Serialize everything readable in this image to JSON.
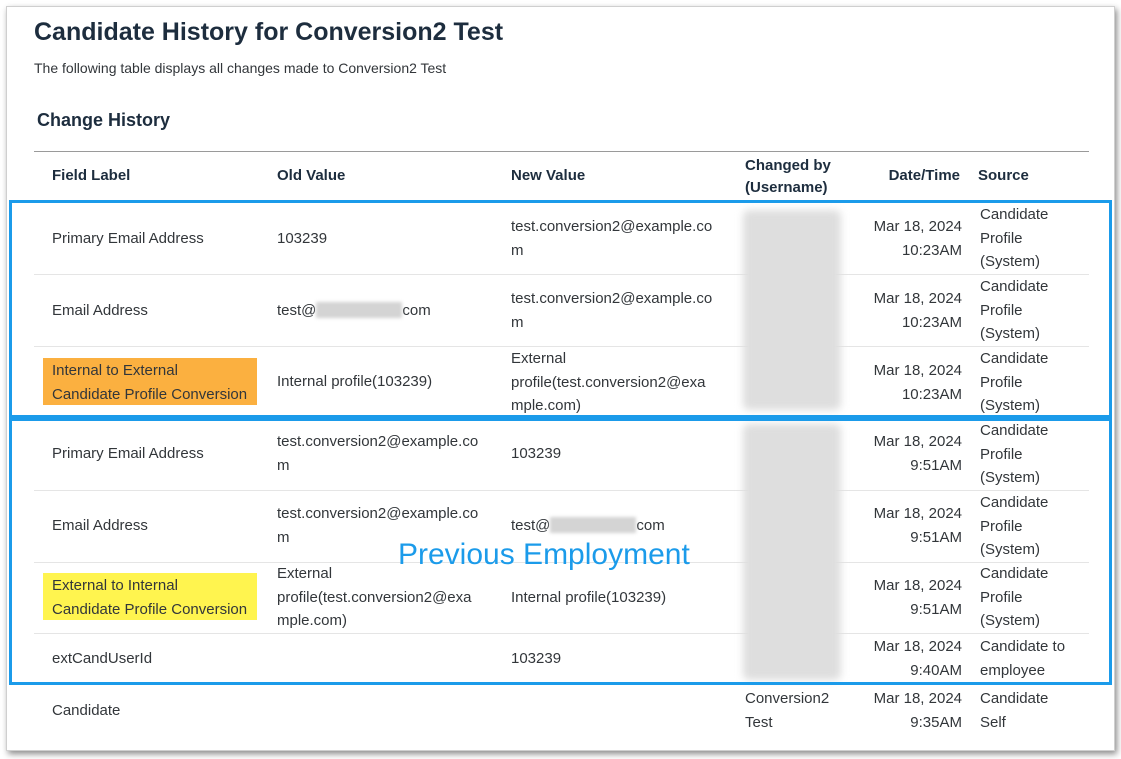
{
  "page": {
    "title": "Candidate History for Conversion2 Test",
    "subtitle": "The following table displays all changes made to Conversion2 Test",
    "section_title": "Change History"
  },
  "table": {
    "columns": {
      "field_label": "Field Label",
      "old_value": "Old Value",
      "new_value": "New Value",
      "changed_by_1": "Changed by",
      "changed_by_2": "(Username)",
      "date_time": "Date/Time",
      "source": "Source"
    },
    "rows": [
      {
        "field": "Primary Email Address",
        "old": "103239",
        "new_1": "test.conversion2@example.co",
        "new_2": "m",
        "date": "Mar 18, 2024",
        "time": "10:23AM",
        "src_1": "Candidate",
        "src_2": "Profile",
        "src_3": "(System)"
      },
      {
        "field": "Email Address",
        "old_pre": "test@",
        "old_post": "com",
        "new_1": "test.conversion2@example.co",
        "new_2": "m",
        "date": "Mar 18, 2024",
        "time": "10:23AM",
        "src_1": "Candidate",
        "src_2": "Profile",
        "src_3": "(System)"
      },
      {
        "field_1": "Internal to External",
        "field_2": "Candidate Profile Conversion",
        "old": "Internal profile(103239)",
        "new_1": "External",
        "new_2": "profile(test.conversion2@exa",
        "new_3": "mple.com)",
        "date": "Mar 18, 2024",
        "time": "10:23AM",
        "src_1": "Candidate",
        "src_2": "Profile",
        "src_3": "(System)"
      },
      {
        "field": "Primary Email Address",
        "old_1": "test.conversion2@example.co",
        "old_2": "m",
        "new": "103239",
        "date": "Mar 18, 2024",
        "time": "9:51AM",
        "src_1": "Candidate",
        "src_2": "Profile",
        "src_3": "(System)"
      },
      {
        "field": "Email Address",
        "old_1": "test.conversion2@example.co",
        "old_2": "m",
        "new_pre": "test@",
        "new_post": "com",
        "date": "Mar 18, 2024",
        "time": "9:51AM",
        "src_1": "Candidate",
        "src_2": "Profile",
        "src_3": "(System)"
      },
      {
        "field_1": "External to Internal",
        "field_2": "Candidate Profile Conversion",
        "old_1": "External",
        "old_2": "profile(test.conversion2@exa",
        "old_3": "mple.com)",
        "new": "Internal profile(103239)",
        "date": "Mar 18, 2024",
        "time": "9:51AM",
        "src_1": "Candidate",
        "src_2": "Profile",
        "src_3": "(System)"
      },
      {
        "field": "extCandUserId",
        "new": "103239",
        "date": "Mar 18, 2024",
        "time": "9:40AM",
        "src_1": "Candidate to",
        "src_2": "employee"
      },
      {
        "field": "Candidate",
        "changed_1": "Conversion2",
        "changed_2": "Test",
        "date": "Mar 18, 2024",
        "time": "9:35AM",
        "src_1": "Candidate",
        "src_2": "Self"
      }
    ]
  },
  "annotation": {
    "label": "Previous Employment",
    "color": "#1b9bea"
  },
  "colors": {
    "highlight_orange": "#fbb040",
    "highlight_yellow": "#fff44f"
  }
}
